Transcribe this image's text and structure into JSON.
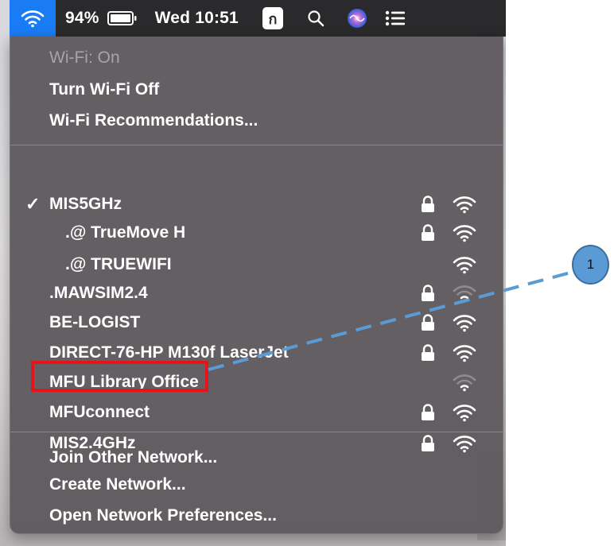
{
  "menubar": {
    "battery_percent": "94%",
    "clock": "Wed 10:51",
    "input_source": "ก"
  },
  "menu": {
    "status": "Wi-Fi: On",
    "actions": [
      "Turn Wi-Fi Off",
      "Wi-Fi Recommendations..."
    ],
    "networks": [
      {
        "name": "MIS5GHz",
        "connected": true,
        "indent": false,
        "locked": true,
        "signal": 3
      },
      {
        "name": ".@ TrueMove H",
        "connected": false,
        "indent": true,
        "locked": true,
        "signal": 3
      },
      {
        "name": ".@ TRUEWIFI",
        "connected": false,
        "indent": true,
        "locked": false,
        "signal": 3
      },
      {
        "name": ".MAWSIM2.4",
        "connected": false,
        "indent": false,
        "locked": true,
        "signal": 1
      },
      {
        "name": "BE-LOGIST",
        "connected": false,
        "indent": false,
        "locked": true,
        "signal": 3
      },
      {
        "name": "DIRECT-76-HP M130f LaserJet",
        "connected": false,
        "indent": false,
        "locked": true,
        "signal": 3
      },
      {
        "name": "MFU Library Office",
        "connected": false,
        "indent": false,
        "locked": false,
        "signal": 1
      },
      {
        "name": "MFUconnect",
        "connected": false,
        "indent": false,
        "locked": true,
        "signal": 3
      },
      {
        "name": "MIS2.4GHz",
        "connected": false,
        "indent": false,
        "locked": true,
        "signal": 3
      }
    ],
    "footer_actions": [
      "Join Other Network...",
      "Create Network...",
      "Open Network Preferences..."
    ]
  },
  "annotation": {
    "badge_number": "1",
    "color": "#5b9bd5",
    "highlight_color": "#e5141b"
  }
}
